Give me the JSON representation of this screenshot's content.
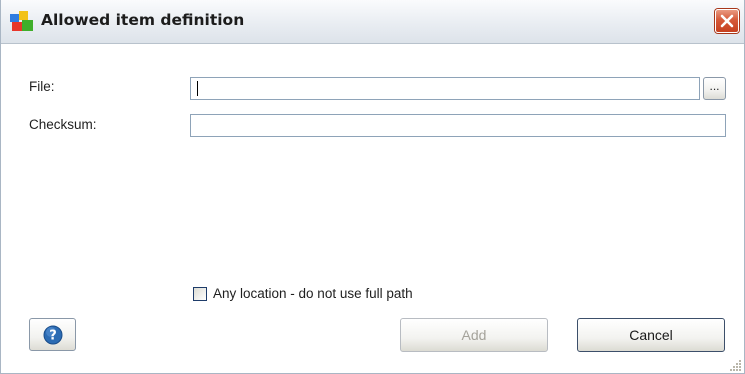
{
  "window": {
    "title": "Allowed item definition",
    "close_icon": "close-icon"
  },
  "form": {
    "file_label": "File:",
    "file_value": "",
    "browse_label": "...",
    "checksum_label": "Checksum:",
    "checksum_value": ""
  },
  "options": {
    "any_location_label": "Any location - do not use full path",
    "any_location_checked": false
  },
  "buttons": {
    "help_icon": "help-icon",
    "add_label": "Add",
    "add_enabled": false,
    "cancel_label": "Cancel"
  },
  "colors": {
    "title_bar": "#e9edf2",
    "close_button": "#d65a3a",
    "help_icon": "#2b6bb3",
    "disabled_text": "#a4a29a"
  }
}
